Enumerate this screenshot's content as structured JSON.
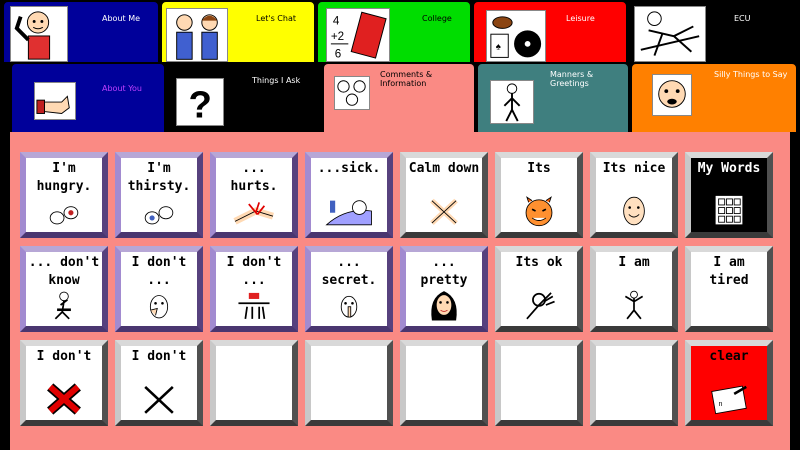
{
  "tabs_row1": [
    {
      "label": "About Me",
      "icon": "man-waving-icon",
      "color": "#00009a"
    },
    {
      "label": "Let's Chat",
      "icon": "people-chatting-icon",
      "color": "#ffff00"
    },
    {
      "label": "College",
      "icon": "math-book-icon",
      "color": "#00dd00"
    },
    {
      "label": "Leisure",
      "icon": "leisure-items-icon",
      "color": "#ff0000"
    },
    {
      "label": "ECU",
      "icon": "person-relaxing-icon",
      "color": "#000000"
    }
  ],
  "tabs_row2": [
    {
      "label": "About You",
      "icon": "pointing-hand-icon",
      "color": "#00009a",
      "text_color": "#c040ff"
    },
    {
      "label": "Things I Ask",
      "icon": "question-mark-icon",
      "color": "#000000",
      "text_color": "#ffffff"
    },
    {
      "label": "Comments & Information",
      "icon": "faces-icon",
      "color": "#fa8a84",
      "text_color": "#000000",
      "active": true
    },
    {
      "label": "Manners & Greetings",
      "icon": "person-greeting-icon",
      "color": "#3f7f7f",
      "text_color": "#ffffff"
    },
    {
      "label": "Silly Things to Say",
      "icon": "silly-face-icon",
      "color": "#ff8000",
      "text_color": "#ffffff"
    }
  ],
  "grid": [
    [
      {
        "label": "I'm\nhungry.",
        "icon": "hungry-icon",
        "style": "purple"
      },
      {
        "label": "I'm\nthirsty.",
        "icon": "thirsty-icon",
        "style": "purple"
      },
      {
        "label": "... hurts.",
        "icon": "hurt-arm-icon",
        "style": "purple"
      },
      {
        "label": "...sick.",
        "icon": "sick-in-bed-icon",
        "style": "purple"
      },
      {
        "label": "Calm down",
        "icon": "calm-down-icon",
        "style": "gray"
      },
      {
        "label": "Its",
        "icon": "devil-face-icon",
        "style": "gray"
      },
      {
        "label": "Its nice",
        "icon": "smiling-face-icon",
        "style": "gray"
      },
      {
        "label": "My Words",
        "icon": "keyboard-icon",
        "style": "dark"
      }
    ],
    [
      {
        "label": "... don't\nknow",
        "icon": "thinking-person-icon",
        "style": "purple"
      },
      {
        "label": "I don't ...",
        "icon": "face-hand-icon",
        "style": "purple"
      },
      {
        "label": "I don't ...",
        "icon": "hands-icon",
        "style": "purple"
      },
      {
        "label": "... secret.",
        "icon": "shh-face-icon",
        "style": "purple"
      },
      {
        "label": "... pretty",
        "icon": "pretty-woman-icon",
        "style": "purple"
      },
      {
        "label": "Its ok",
        "icon": "ok-hand-icon",
        "style": "gray"
      },
      {
        "label": "I am",
        "icon": "jumping-person-icon",
        "style": "gray"
      },
      {
        "label": "I am tired",
        "icon": "",
        "style": "gray"
      }
    ],
    [
      {
        "label": "I don't",
        "icon": "red-x-icon",
        "style": "gray"
      },
      {
        "label": "I don't",
        "icon": "black-x-icon",
        "style": "gray"
      },
      {
        "label": "",
        "icon": "",
        "style": "gray"
      },
      {
        "label": "",
        "icon": "",
        "style": "gray"
      },
      {
        "label": "",
        "icon": "",
        "style": "gray"
      },
      {
        "label": "",
        "icon": "",
        "style": "gray"
      },
      {
        "label": "",
        "icon": "",
        "style": "gray"
      },
      {
        "label": "clear",
        "icon": "eraser-icon",
        "style": "red"
      }
    ]
  ]
}
